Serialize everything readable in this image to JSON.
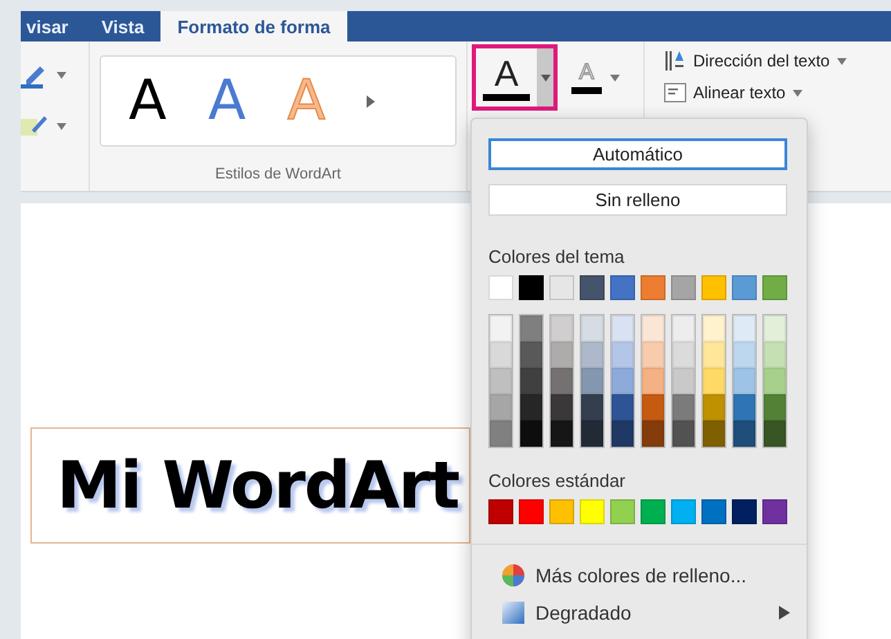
{
  "tabs": [
    {
      "label": "visar",
      "selected": false
    },
    {
      "label": "Vista",
      "selected": false
    },
    {
      "label": "Formato de forma",
      "selected": true
    }
  ],
  "ribbon": {
    "wordart_styles": [
      {
        "label": "A",
        "kind": "black"
      },
      {
        "label": "A",
        "kind": "blue"
      },
      {
        "label": "A",
        "kind": "orange"
      }
    ],
    "group_label": "Estilos de WordArt",
    "text_fill": {
      "label": "A",
      "selected": true
    },
    "text_outline": {
      "label": "A"
    },
    "text_direction": "Dirección del texto",
    "align_text": "Alinear texto"
  },
  "document": {
    "wordart_text": "Mi WordArt"
  },
  "fill_menu": {
    "automatic": {
      "label": "Automático",
      "selected": true
    },
    "no_fill": {
      "label": "Sin relleno",
      "selected": false
    },
    "theme_title": "Colores del tema",
    "theme_colors": [
      {
        "color": "#ffffff",
        "shades": [
          {
            "color": "#f2f2f2"
          },
          {
            "color": "#d9d9d9"
          },
          {
            "color": "#bfbfbf"
          },
          {
            "color": "#a6a6a6"
          },
          {
            "color": "#808080"
          }
        ]
      },
      {
        "color": "#000000",
        "shades": [
          {
            "color": "#7f7f7f"
          },
          {
            "color": "#595959"
          },
          {
            "color": "#404040"
          },
          {
            "color": "#262626"
          },
          {
            "color": "#0d0d0d"
          }
        ]
      },
      {
        "color": "#e7e6e6",
        "shades": [
          {
            "color": "#d0cece"
          },
          {
            "color": "#aeabab"
          },
          {
            "color": "#757171"
          },
          {
            "color": "#3a3838"
          },
          {
            "color": "#171616"
          }
        ]
      },
      {
        "color": "#44546a",
        "shades": [
          {
            "color": "#d6dce4"
          },
          {
            "color": "#adb9ca"
          },
          {
            "color": "#8497b0"
          },
          {
            "color": "#333f4f"
          },
          {
            "color": "#222a35"
          }
        ]
      },
      {
        "color": "#4472c4",
        "shades": [
          {
            "color": "#d9e2f3"
          },
          {
            "color": "#b4c6e7"
          },
          {
            "color": "#8eaadb"
          },
          {
            "color": "#2f5496"
          },
          {
            "color": "#1f3864"
          }
        ]
      },
      {
        "color": "#ed7d31",
        "shades": [
          {
            "color": "#fbe5d5"
          },
          {
            "color": "#f7cbac"
          },
          {
            "color": "#f4b183"
          },
          {
            "color": "#c55a11"
          },
          {
            "color": "#843c0b"
          }
        ]
      },
      {
        "color": "#a5a5a5",
        "shades": [
          {
            "color": "#ededed"
          },
          {
            "color": "#dbdbdb"
          },
          {
            "color": "#c9c9c9"
          },
          {
            "color": "#7b7b7b"
          },
          {
            "color": "#525252"
          }
        ]
      },
      {
        "color": "#ffc000",
        "shades": [
          {
            "color": "#fff2cc"
          },
          {
            "color": "#ffe699"
          },
          {
            "color": "#ffd966"
          },
          {
            "color": "#bf9000"
          },
          {
            "color": "#7f6000"
          }
        ]
      },
      {
        "color": "#5b9bd5",
        "shades": [
          {
            "color": "#deebf6"
          },
          {
            "color": "#bdd7ee"
          },
          {
            "color": "#9dc3e6"
          },
          {
            "color": "#2e75b5"
          },
          {
            "color": "#1e4e79"
          }
        ]
      },
      {
        "color": "#70ad47",
        "shades": [
          {
            "color": "#e2efd9"
          },
          {
            "color": "#c5e0b3"
          },
          {
            "color": "#a8d08d"
          },
          {
            "color": "#538135"
          },
          {
            "color": "#375623"
          }
        ]
      }
    ],
    "standard_title": "Colores estándar",
    "standard_colors": [
      {
        "color": "#c00000"
      },
      {
        "color": "#ff0000"
      },
      {
        "color": "#ffc000"
      },
      {
        "color": "#ffff00"
      },
      {
        "color": "#92d050"
      },
      {
        "color": "#00b050"
      },
      {
        "color": "#00b0f0"
      },
      {
        "color": "#0070c0"
      },
      {
        "color": "#002060"
      },
      {
        "color": "#7030a0"
      }
    ],
    "items": [
      {
        "label": "Más colores de relleno...",
        "kind": "colors",
        "submenu": false
      },
      {
        "label": "Degradado",
        "kind": "gradient",
        "submenu": true
      }
    ]
  }
}
